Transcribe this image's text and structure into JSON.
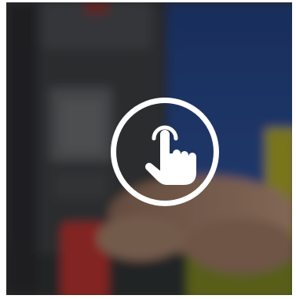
{
  "overlay": {
    "action_icon": "tap-finger-icon",
    "ring_color": "#ffffff",
    "tint_color": "#000000"
  },
  "background": {
    "subject": "gas-detector-in-hand-photo",
    "device_color": "#2f3133",
    "accent_yellow": "#c8b020",
    "accent_red": "#b5332e",
    "jacket_blue": "#2a4a8a"
  }
}
